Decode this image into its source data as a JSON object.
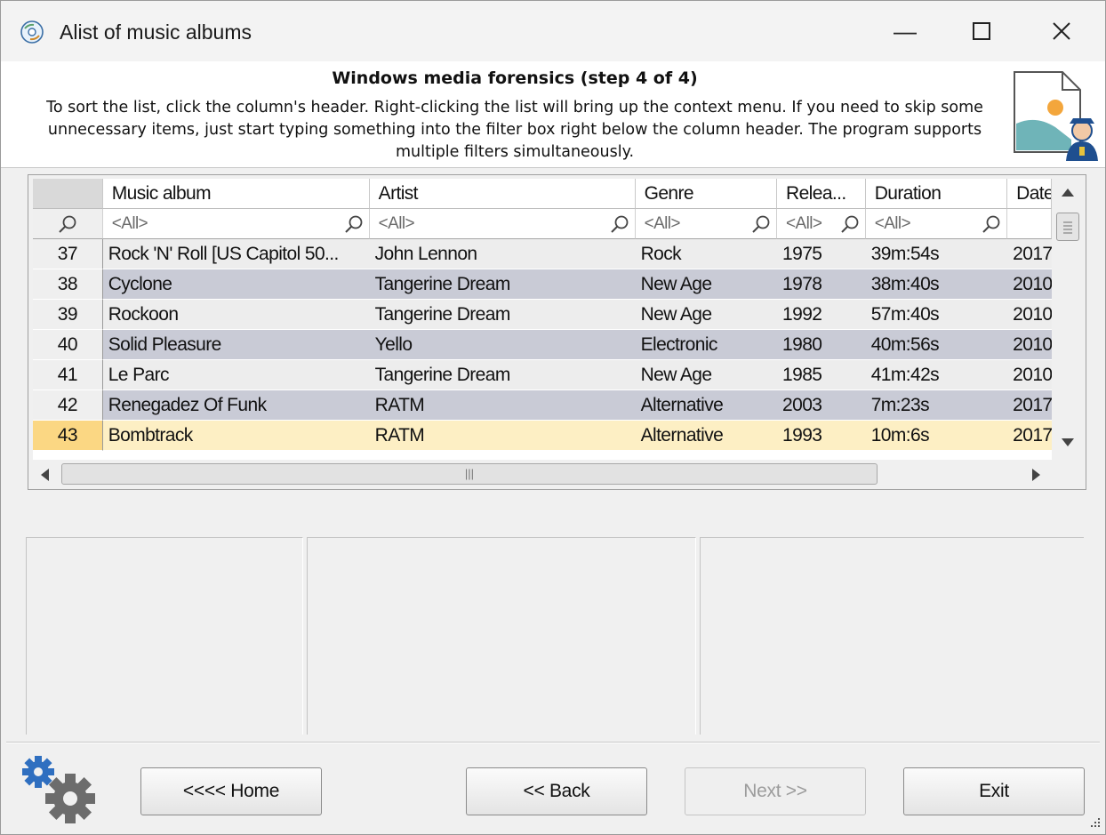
{
  "window": {
    "title": "Alist of music albums",
    "minimize_glyph": "—",
    "maximize_glyph": "☐",
    "close_glyph": "✕"
  },
  "header": {
    "step_title": "Windows media forensics (step 4 of 4)",
    "description": "To sort the list, click the column's header. Right-clicking the list will bring up the context menu. If you need to skip some unnecessary items, just start typing something into the filter box right below the column header. The program supports multiple filters simultaneously."
  },
  "grid": {
    "columns": [
      "Music album",
      "Artist",
      "Genre",
      "Relea...",
      "Duration",
      "Date"
    ],
    "filter_placeholder": "<All>",
    "rows": [
      {
        "num": "37",
        "album": "Rock 'N' Roll [US Capitol 50...",
        "artist": "John Lennon",
        "genre": "Rock",
        "release": "1975",
        "duration": "39m:54s",
        "date": "2017"
      },
      {
        "num": "38",
        "album": "Cyclone",
        "artist": "Tangerine Dream",
        "genre": "New Age",
        "release": "1978",
        "duration": "38m:40s",
        "date": "2010"
      },
      {
        "num": "39",
        "album": "Rockoon",
        "artist": "Tangerine Dream",
        "genre": "New Age",
        "release": "1992",
        "duration": "57m:40s",
        "date": "2010"
      },
      {
        "num": "40",
        "album": "Solid Pleasure",
        "artist": "Yello",
        "genre": "Electronic",
        "release": "1980",
        "duration": "40m:56s",
        "date": "2010"
      },
      {
        "num": "41",
        "album": "Le Parc",
        "artist": "Tangerine Dream",
        "genre": "New Age",
        "release": "1985",
        "duration": "41m:42s",
        "date": "2010"
      },
      {
        "num": "42",
        "album": "Renegadez Of Funk",
        "artist": "RATM",
        "genre": "Alternative",
        "release": "2003",
        "duration": "7m:23s",
        "date": "2017"
      },
      {
        "num": "43",
        "album": "Bombtrack",
        "artist": "RATM",
        "genre": "Alternative",
        "release": "1993",
        "duration": "10m:6s",
        "date": "2017"
      }
    ],
    "selected_row": "43",
    "hscroll_grip": "|||"
  },
  "buttons": {
    "home": "<<<< Home",
    "back": "<< Back",
    "next": "Next >>",
    "exit": "Exit"
  },
  "colors": {
    "row_light": "#ededed",
    "row_dark": "#c9cbd6",
    "row_selected": "#fdefc4",
    "rownum_selected": "#fbd783",
    "gear_blue": "#2f6fc0",
    "gear_gray": "#6c6c6c"
  }
}
